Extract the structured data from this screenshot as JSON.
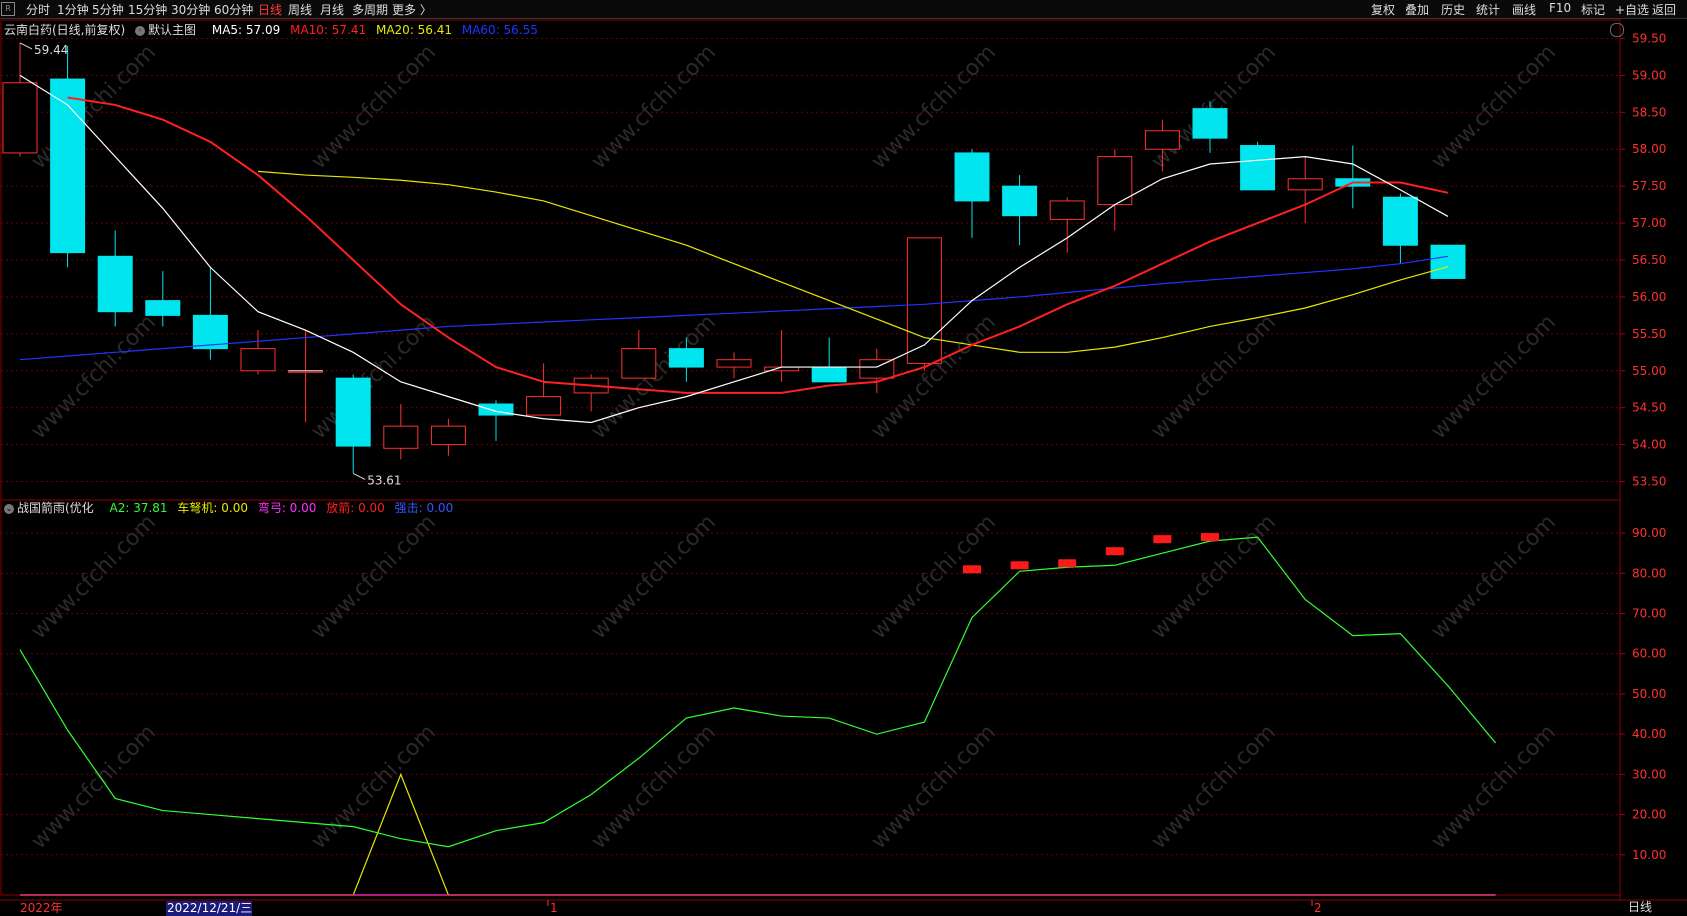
{
  "topbar": {
    "left_items": [
      "分时",
      "1分钟",
      "5分钟",
      "15分钟",
      "30分钟",
      "60分钟",
      "日线",
      "周线",
      "月线",
      "多周期",
      "更多 〉"
    ],
    "active_item": "日线",
    "right_items": [
      "复权",
      "叠加",
      "历史",
      "统计",
      "画线",
      "F10",
      "标记",
      "+自选",
      "返回"
    ]
  },
  "main_legend": {
    "title": "云南白药(日线,前复权)",
    "template": "默认主图",
    "ma5": {
      "label": "MA5: 57.09",
      "color": "#ffffff"
    },
    "ma10": {
      "label": "MA10: 57.41",
      "color": "#ff2020"
    },
    "ma20": {
      "label": "MA20: 56.41",
      "color": "#e8e800"
    },
    "ma60": {
      "label": "MA60: 56.55",
      "color": "#2233ff"
    }
  },
  "sub_legend": {
    "title": "战国箭雨(优化",
    "a2": {
      "label": "A2: 37.81",
      "color": "#33ff33"
    },
    "che": {
      "label": "车弩机: 0.00",
      "color": "#e8e800"
    },
    "wan": {
      "label": "弯弓: 0.00",
      "color": "#ff33ff"
    },
    "fang": {
      "label": "放箭: 0.00",
      "color": "#ff2020"
    },
    "qiang": {
      "label": "强击: 0.00",
      "color": "#3355ff"
    }
  },
  "bottom": {
    "year_label": "2022年",
    "date_label": "2022/12/21/三",
    "mark1": "1",
    "mark2": "2",
    "period_tab": "日线"
  },
  "watermark": "www.cfchi.com",
  "chart_data": [
    {
      "type": "candlestick",
      "title": "云南白药(日线,前复权)",
      "ylim": [
        53.25,
        59.75
      ],
      "y_ticks": [
        "59.50",
        "59.00",
        "58.50",
        "58.00",
        "57.50",
        "57.00",
        "56.50",
        "56.00",
        "55.50",
        "55.00",
        "54.50",
        "54.00",
        "53.50"
      ],
      "high_label": "59.44",
      "low_label": "53.61",
      "candles": [
        {
          "o": 57.95,
          "h": 59.44,
          "l": 57.9,
          "c": 58.9
        },
        {
          "o": 58.95,
          "h": 59.4,
          "l": 56.4,
          "c": 56.6
        },
        {
          "o": 56.55,
          "h": 56.9,
          "l": 55.6,
          "c": 55.8
        },
        {
          "o": 55.95,
          "h": 56.35,
          "l": 55.6,
          "c": 55.75
        },
        {
          "o": 55.75,
          "h": 56.4,
          "l": 55.15,
          "c": 55.3
        },
        {
          "o": 55.0,
          "h": 55.55,
          "l": 54.95,
          "c": 55.3
        },
        {
          "o": 55.0,
          "h": 55.55,
          "l": 54.3,
          "c": 55.0
        },
        {
          "o": 54.9,
          "h": 54.95,
          "l": 53.61,
          "c": 53.98
        },
        {
          "o": 53.95,
          "h": 54.55,
          "l": 53.8,
          "c": 54.25
        },
        {
          "o": 54.0,
          "h": 54.35,
          "l": 53.85,
          "c": 54.25
        },
        {
          "o": 54.55,
          "h": 54.6,
          "l": 54.05,
          "c": 54.4
        },
        {
          "o": 54.4,
          "h": 55.1,
          "l": 54.4,
          "c": 54.65
        },
        {
          "o": 54.7,
          "h": 54.95,
          "l": 54.45,
          "c": 54.9
        },
        {
          "o": 54.9,
          "h": 55.55,
          "l": 54.9,
          "c": 55.3
        },
        {
          "o": 55.3,
          "h": 55.45,
          "l": 54.85,
          "c": 55.05
        },
        {
          "o": 55.05,
          "h": 55.25,
          "l": 54.9,
          "c": 55.15
        },
        {
          "o": 55.0,
          "h": 55.55,
          "l": 54.85,
          "c": 55.05
        },
        {
          "o": 55.05,
          "h": 55.45,
          "l": 54.85,
          "c": 54.85
        },
        {
          "o": 54.9,
          "h": 55.3,
          "l": 54.7,
          "c": 55.15
        },
        {
          "o": 55.1,
          "h": 56.8,
          "l": 55.0,
          "c": 56.8
        },
        {
          "o": 57.95,
          "h": 58.0,
          "l": 56.8,
          "c": 57.3
        },
        {
          "o": 57.5,
          "h": 57.65,
          "l": 56.7,
          "c": 57.1
        },
        {
          "o": 57.05,
          "h": 57.35,
          "l": 56.6,
          "c": 57.3
        },
        {
          "o": 57.25,
          "h": 58.0,
          "l": 56.9,
          "c": 57.9
        },
        {
          "o": 58.0,
          "h": 58.4,
          "l": 57.7,
          "c": 58.25
        },
        {
          "o": 58.55,
          "h": 58.65,
          "l": 57.95,
          "c": 58.15
        },
        {
          "o": 58.05,
          "h": 58.1,
          "l": 57.45,
          "c": 57.45
        },
        {
          "o": 57.45,
          "h": 57.9,
          "l": 57.0,
          "c": 57.6
        },
        {
          "o": 57.6,
          "h": 58.05,
          "l": 57.2,
          "c": 57.5
        },
        {
          "o": 57.35,
          "h": 57.4,
          "l": 56.45,
          "c": 56.7
        },
        {
          "o": 56.7,
          "h": 56.7,
          "l": 56.25,
          "c": 56.25
        }
      ],
      "ma5": [
        59.0,
        58.6,
        57.9,
        57.2,
        56.4,
        55.8,
        55.55,
        55.25,
        54.85,
        54.65,
        54.45,
        54.35,
        54.3,
        54.5,
        54.65,
        54.85,
        55.05,
        55.05,
        55.05,
        55.35,
        55.95,
        56.4,
        56.8,
        57.25,
        57.6,
        57.8,
        57.85,
        57.9,
        57.8,
        57.45,
        57.09
      ],
      "ma10": [
        58.7,
        58.6,
        58.4,
        58.1,
        57.65,
        57.1,
        56.5,
        55.9,
        55.45,
        55.05,
        54.85,
        54.8,
        54.75,
        54.7,
        54.7,
        54.7,
        54.8,
        54.85,
        55.05,
        55.35,
        55.6,
        55.9,
        56.15,
        56.45,
        56.75,
        57.0,
        57.25,
        57.55,
        57.55,
        57.41
      ],
      "ma20": [
        57.7,
        57.65,
        57.62,
        57.58,
        57.52,
        57.42,
        57.3,
        57.1,
        56.9,
        56.7,
        56.45,
        56.2,
        55.95,
        55.7,
        55.45,
        55.35,
        55.25,
        55.25,
        55.32,
        55.45,
        55.6,
        55.72,
        55.85,
        56.03,
        56.23,
        56.41
      ],
      "ma60": [
        55.15,
        55.2,
        55.25,
        55.3,
        55.35,
        55.4,
        55.45,
        55.5,
        55.55,
        55.6,
        55.63,
        55.66,
        55.69,
        55.72,
        55.75,
        55.78,
        55.81,
        55.84,
        55.87,
        55.9,
        55.95,
        56.0,
        56.06,
        56.12,
        56.18,
        56.23,
        56.28,
        56.33,
        56.38,
        56.45,
        56.55
      ]
    },
    {
      "type": "line",
      "title": "战国箭雨(优化",
      "ylim": [
        0,
        95
      ],
      "y_ticks": [
        "90.00",
        "80.00",
        "70.00",
        "60.00",
        "50.00",
        "40.00",
        "30.00",
        "20.00",
        "10.00"
      ],
      "series": [
        {
          "name": "A2",
          "color": "#33ff33",
          "values": [
            61,
            41,
            24,
            21,
            20,
            19,
            18,
            17,
            14,
            12,
            16,
            18,
            25,
            34,
            44,
            46.5,
            44.5,
            44,
            40,
            43,
            69,
            80.5,
            81.5,
            82,
            85,
            88,
            89,
            73.5,
            64.5,
            65,
            52,
            37.81
          ]
        },
        {
          "name": "车弩机",
          "color": "#e8e800",
          "values": [
            0,
            0,
            0,
            0,
            0,
            0,
            0,
            0,
            30,
            0,
            0,
            0,
            0,
            0,
            0,
            0,
            0,
            0,
            0,
            0,
            0,
            0,
            0,
            0,
            0,
            0,
            0,
            0,
            0,
            0,
            0,
            0
          ]
        },
        {
          "name": "放箭",
          "color": "#ff2020",
          "markers": [
            {
              "i": 20,
              "v": 81
            },
            {
              "i": 21,
              "v": 82
            },
            {
              "i": 22,
              "v": 82.5
            },
            {
              "i": 23,
              "v": 85.5
            },
            {
              "i": 24,
              "v": 88.5
            },
            {
              "i": 25,
              "v": 89
            }
          ]
        }
      ]
    }
  ]
}
